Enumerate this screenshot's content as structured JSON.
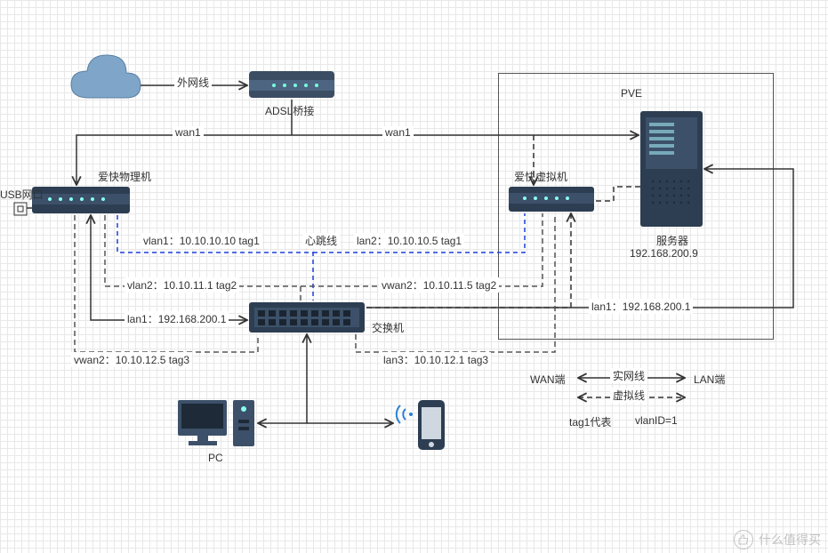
{
  "diagram": {
    "title_pve": "PVE",
    "nodes": {
      "cloud": "",
      "adsl_label": "ADSL桥接",
      "aikuai_phys": "爱快物理机",
      "aikuai_virt": "爱快虚拟机",
      "usb_port": "USB网口",
      "server_name": "服务器",
      "server_ip": "192.168.200.9",
      "switch": "交换机",
      "pc": "PC"
    },
    "edges": {
      "ext_line": "外网线",
      "wan1_left": "wan1",
      "wan1_right": "wan1",
      "heartbeat": "心跳线",
      "vlan1": "vlan1：10.10.10.10 tag1",
      "lan2": "lan2：10.10.10.5 tag1",
      "vlan2": "vlan2：10.10.11.1 tag2",
      "vwan2": "vwan2：10.10.11.5 tag2",
      "lan1_left": "lan1：192.168.200.1",
      "lan1_right": "lan1：192.168.200.1",
      "vwan2_b": "vwan2：10.10.12.5 tag3",
      "lan3": "lan3：10.10.12.1 tag3"
    },
    "legend": {
      "wan_side": "WAN端",
      "lan_side": "LAN端",
      "solid_line": "实网线",
      "dashed_line": "虚拟线",
      "tag_note": "tag1代表",
      "tag_note2": "vlanID=1"
    }
  }
}
